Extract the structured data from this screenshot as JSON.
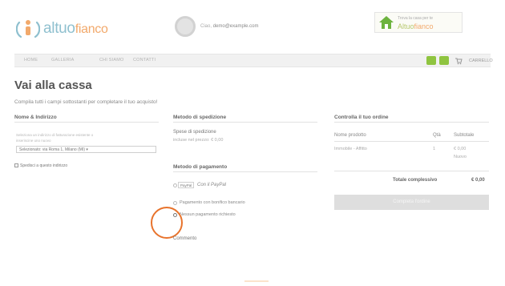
{
  "header": {
    "logo_main": "altuo",
    "logo_accent": "fianco",
    "user_label": "Ciao,",
    "user_email": "demo@example.com",
    "badge_line1": "Trova la casa per te",
    "badge_brand_a": "Altuo",
    "badge_brand_b": "fianco"
  },
  "nav": {
    "items": [
      "HOME",
      "GALLERIA",
      "CHI SIAMO",
      "CONTATTI"
    ],
    "cart_label": "CARRELLO"
  },
  "page": {
    "title": "Vai alla cassa",
    "subtitle": "Compila tutti i campi sottostanti per completare il tuo acquisto!"
  },
  "address": {
    "heading": "Nome & Indirizzo",
    "line1": "Seleziona un indirizzo di fatturazione esistente o",
    "line2": "inseriscine uno nuovo",
    "selected": "Selezionato: via Roma 1, Milano (MI) ▾",
    "new_link": "Spedisci a questo indirizzo"
  },
  "shipping": {
    "heading": "Metodo di spedizione",
    "label": "Spese di spedizione",
    "value": "incluse nel prezzo: € 0,00"
  },
  "payment": {
    "heading": "Metodo di pagamento",
    "paypal_badge": "PayPal",
    "paypal_label": "Con il PayPal",
    "bank_label": "Pagamento con bonifico bancario",
    "tax_label": "Nessun pagamento richiesto"
  },
  "order": {
    "heading": "Controlla il tuo ordine",
    "col_product": "Nome prodotto",
    "col_qty": "Qtà",
    "col_subtotal": "Subtotale",
    "rows": [
      {
        "name": "Immobile - Affitto",
        "qty": "1",
        "subtotal": "€ 0,00",
        "subtotal_note": "Nuovo"
      }
    ],
    "total_label": "Totale complessivo",
    "total_value": "€ 0,00",
    "submit_label": "Completa l'ordine"
  },
  "comments": {
    "heading": "Commento"
  },
  "colors": {
    "brand_blue": "#8fc0cf",
    "brand_orange": "#f2a96b",
    "nav_green": "#8fc440",
    "annotation": "#e8732c"
  }
}
